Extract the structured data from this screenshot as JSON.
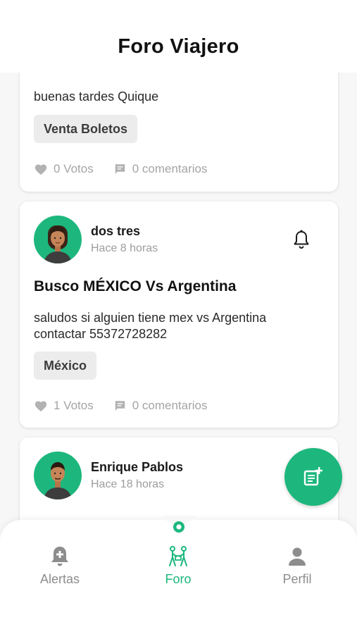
{
  "app": {
    "title": "Foro Viajero"
  },
  "posts": [
    {
      "body": "buenas tardes Quique",
      "tag": "Venta Boletos",
      "votes": "0 Votos",
      "comments": "0 comentarios"
    },
    {
      "author": "dos tres",
      "time": "Hace 8 horas",
      "title": "Busco MÉXICO Vs Argentina",
      "body_line1": "saludos si alguien tiene mex vs Argentina",
      "body_line2": "contactar 55372728282",
      "tag": "México",
      "votes": "1 Votos",
      "comments": "0 comentarios"
    },
    {
      "author": "Enrique Pablos",
      "time": "Hace 18 horas"
    }
  ],
  "tabs": [
    {
      "label": "Alertas",
      "icon": "alert-bell-plus-icon"
    },
    {
      "label": "Foro",
      "icon": "forum-people-icon",
      "active": true
    },
    {
      "label": "Perfil",
      "icon": "person-icon"
    }
  ],
  "colors": {
    "accent": "#1db77d",
    "muted": "#a4a4a4",
    "tag_bg": "#ececec"
  }
}
